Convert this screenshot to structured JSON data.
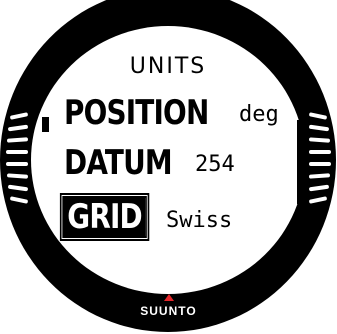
{
  "screen": {
    "title": "UNITS",
    "rows": [
      {
        "label": "POSITION",
        "value": "deg"
      },
      {
        "label": "DATUM",
        "value": "254"
      },
      {
        "label": "GRID",
        "value": "Swiss"
      }
    ],
    "selected_row": "GRID"
  },
  "brand": {
    "name": "SUUNTO",
    "mark_icon": "suunto-triangle-icon",
    "mark_color": "#e4262a"
  },
  "colors": {
    "bezel": "#000000",
    "lcd_background": "#ffffff",
    "lcd_text": "#000000"
  }
}
